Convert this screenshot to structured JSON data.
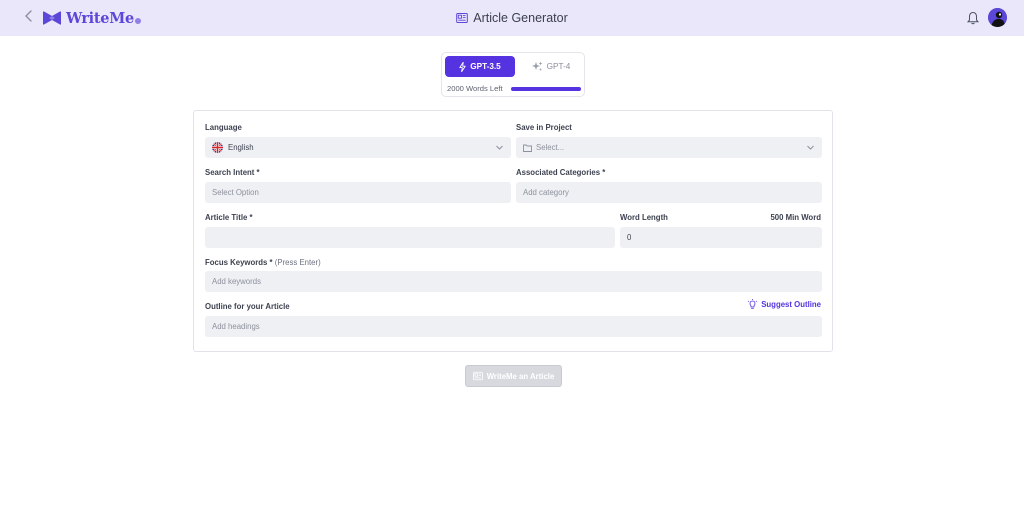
{
  "header": {
    "brand": "WriteMe",
    "title": "Article Generator",
    "icons": {
      "back": "chevron-left-icon",
      "title": "article-icon",
      "notifications": "bell-icon"
    },
    "colors": {
      "header_bg": "#ebe7fb",
      "brand": "#5b47d8"
    }
  },
  "model": {
    "tabs": [
      {
        "label": "GPT-3.5",
        "active": true,
        "icon": "bolt-icon"
      },
      {
        "label": "GPT-4",
        "active": false,
        "icon": "sparkle-icon"
      }
    ],
    "words_left": "2000 Words Left",
    "words_progress_fraction": 1.0,
    "accent": "#5533e0"
  },
  "form": {
    "language": {
      "label": "Language",
      "value": "English",
      "flag": "uk-flag-icon"
    },
    "project": {
      "label": "Save in Project",
      "placeholder": "Select..."
    },
    "intent": {
      "label": "Search Intent *",
      "placeholder": "Select Option"
    },
    "categories": {
      "label": "Associated Categories *",
      "placeholder": "Add category"
    },
    "title": {
      "label": "Article Title *",
      "value": ""
    },
    "word_length": {
      "label": "Word Length",
      "note": "500 Min Word",
      "value": "0"
    },
    "keywords": {
      "label": "Focus Keywords *",
      "hint": "(Press Enter)",
      "placeholder": "Add keywords"
    },
    "outline": {
      "label": "Outline for your Article",
      "suggest": "Suggest Outline",
      "placeholder": "Add headings"
    }
  },
  "submit": {
    "label": "WriteMe an Article",
    "disabled": true
  }
}
